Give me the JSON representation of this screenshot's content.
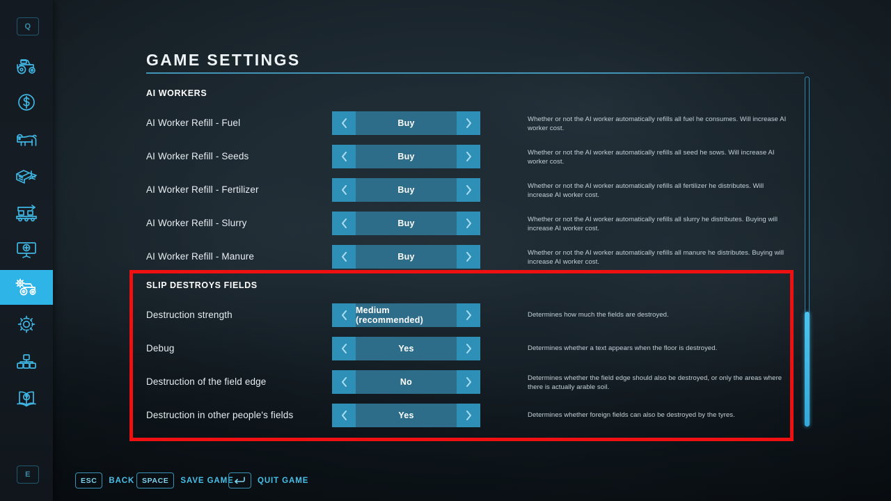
{
  "colors": {
    "accent": "#2fb4e8",
    "control_bg": "#2d6d89",
    "control_arrow": "#2e90b7",
    "highlight_box": "#ef1111",
    "text": "#e7eef2"
  },
  "sidebar": {
    "top_key": {
      "label": "Q",
      "name": "key-q"
    },
    "bottom_key": {
      "label": "E",
      "name": "key-e"
    },
    "items": [
      {
        "icon": "tractor-icon",
        "label": "Vehicles",
        "active": false
      },
      {
        "icon": "dollar-coin-icon",
        "label": "Finances",
        "active": false
      },
      {
        "icon": "cow-icon",
        "label": "Animals",
        "active": false
      },
      {
        "icon": "documents-icon",
        "label": "Contracts",
        "active": false
      },
      {
        "icon": "production-conveyor-icon",
        "label": "Production",
        "active": false
      },
      {
        "icon": "presentation-screen-icon",
        "label": "Statistics",
        "active": false
      },
      {
        "icon": "tractor-gear-icon",
        "label": "Game Settings",
        "active": true
      },
      {
        "icon": "gear-icon",
        "label": "General Settings",
        "active": false
      },
      {
        "icon": "nodes-icon",
        "label": "Multiplayer",
        "active": false
      },
      {
        "icon": "book-help-icon",
        "label": "Help",
        "active": false
      }
    ]
  },
  "header": {
    "title": "GAME SETTINGS"
  },
  "sections": [
    {
      "heading": "AI WORKERS",
      "rows": [
        {
          "label": "AI Worker Refill - Fuel",
          "value": "Buy",
          "description": "Whether or not the AI worker automatically refills all fuel he consumes. Will increase AI worker cost."
        },
        {
          "label": "AI Worker Refill - Seeds",
          "value": "Buy",
          "description": "Whether or not the AI worker automatically refills all seed he sows. Will increase AI worker cost."
        },
        {
          "label": "AI Worker Refill - Fertilizer",
          "value": "Buy",
          "description": "Whether or not the AI worker automatically refills all fertilizer he distributes. Will increase AI worker cost."
        },
        {
          "label": "AI Worker Refill - Slurry",
          "value": "Buy",
          "description": "Whether or not the AI worker automatically refills all slurry he distributes. Buying will increase AI worker cost."
        },
        {
          "label": "AI Worker Refill - Manure",
          "value": "Buy",
          "description": "Whether or not the AI worker automatically refills all manure he distributes. Buying will increase AI worker cost."
        }
      ]
    },
    {
      "heading": "SLIP DESTROYS FIELDS",
      "rows": [
        {
          "label": "Destruction strength",
          "value": "Medium (recommended)",
          "description": "Determines how much the fields are destroyed."
        },
        {
          "label": "Debug",
          "value": "Yes",
          "description": "Determines whether a text appears when the floor is destroyed."
        },
        {
          "label": "Destruction of the field edge",
          "value": "No",
          "description": "Determines whether the field edge should also be destroyed, or only the areas where there is actually arable soil."
        },
        {
          "label": "Destruction in other people's fields",
          "value": "Yes",
          "description": "Determines whether foreign fields can also be destroyed by the tyres."
        }
      ]
    }
  ],
  "footer": {
    "hints": [
      {
        "key": "ESC",
        "key_icon": "",
        "action": "BACK"
      },
      {
        "key": "SPACE",
        "key_icon": "",
        "action": "SAVE GAME"
      },
      {
        "key": "",
        "key_icon": "backspace-arrow-icon",
        "action": "QUIT GAME"
      }
    ]
  }
}
